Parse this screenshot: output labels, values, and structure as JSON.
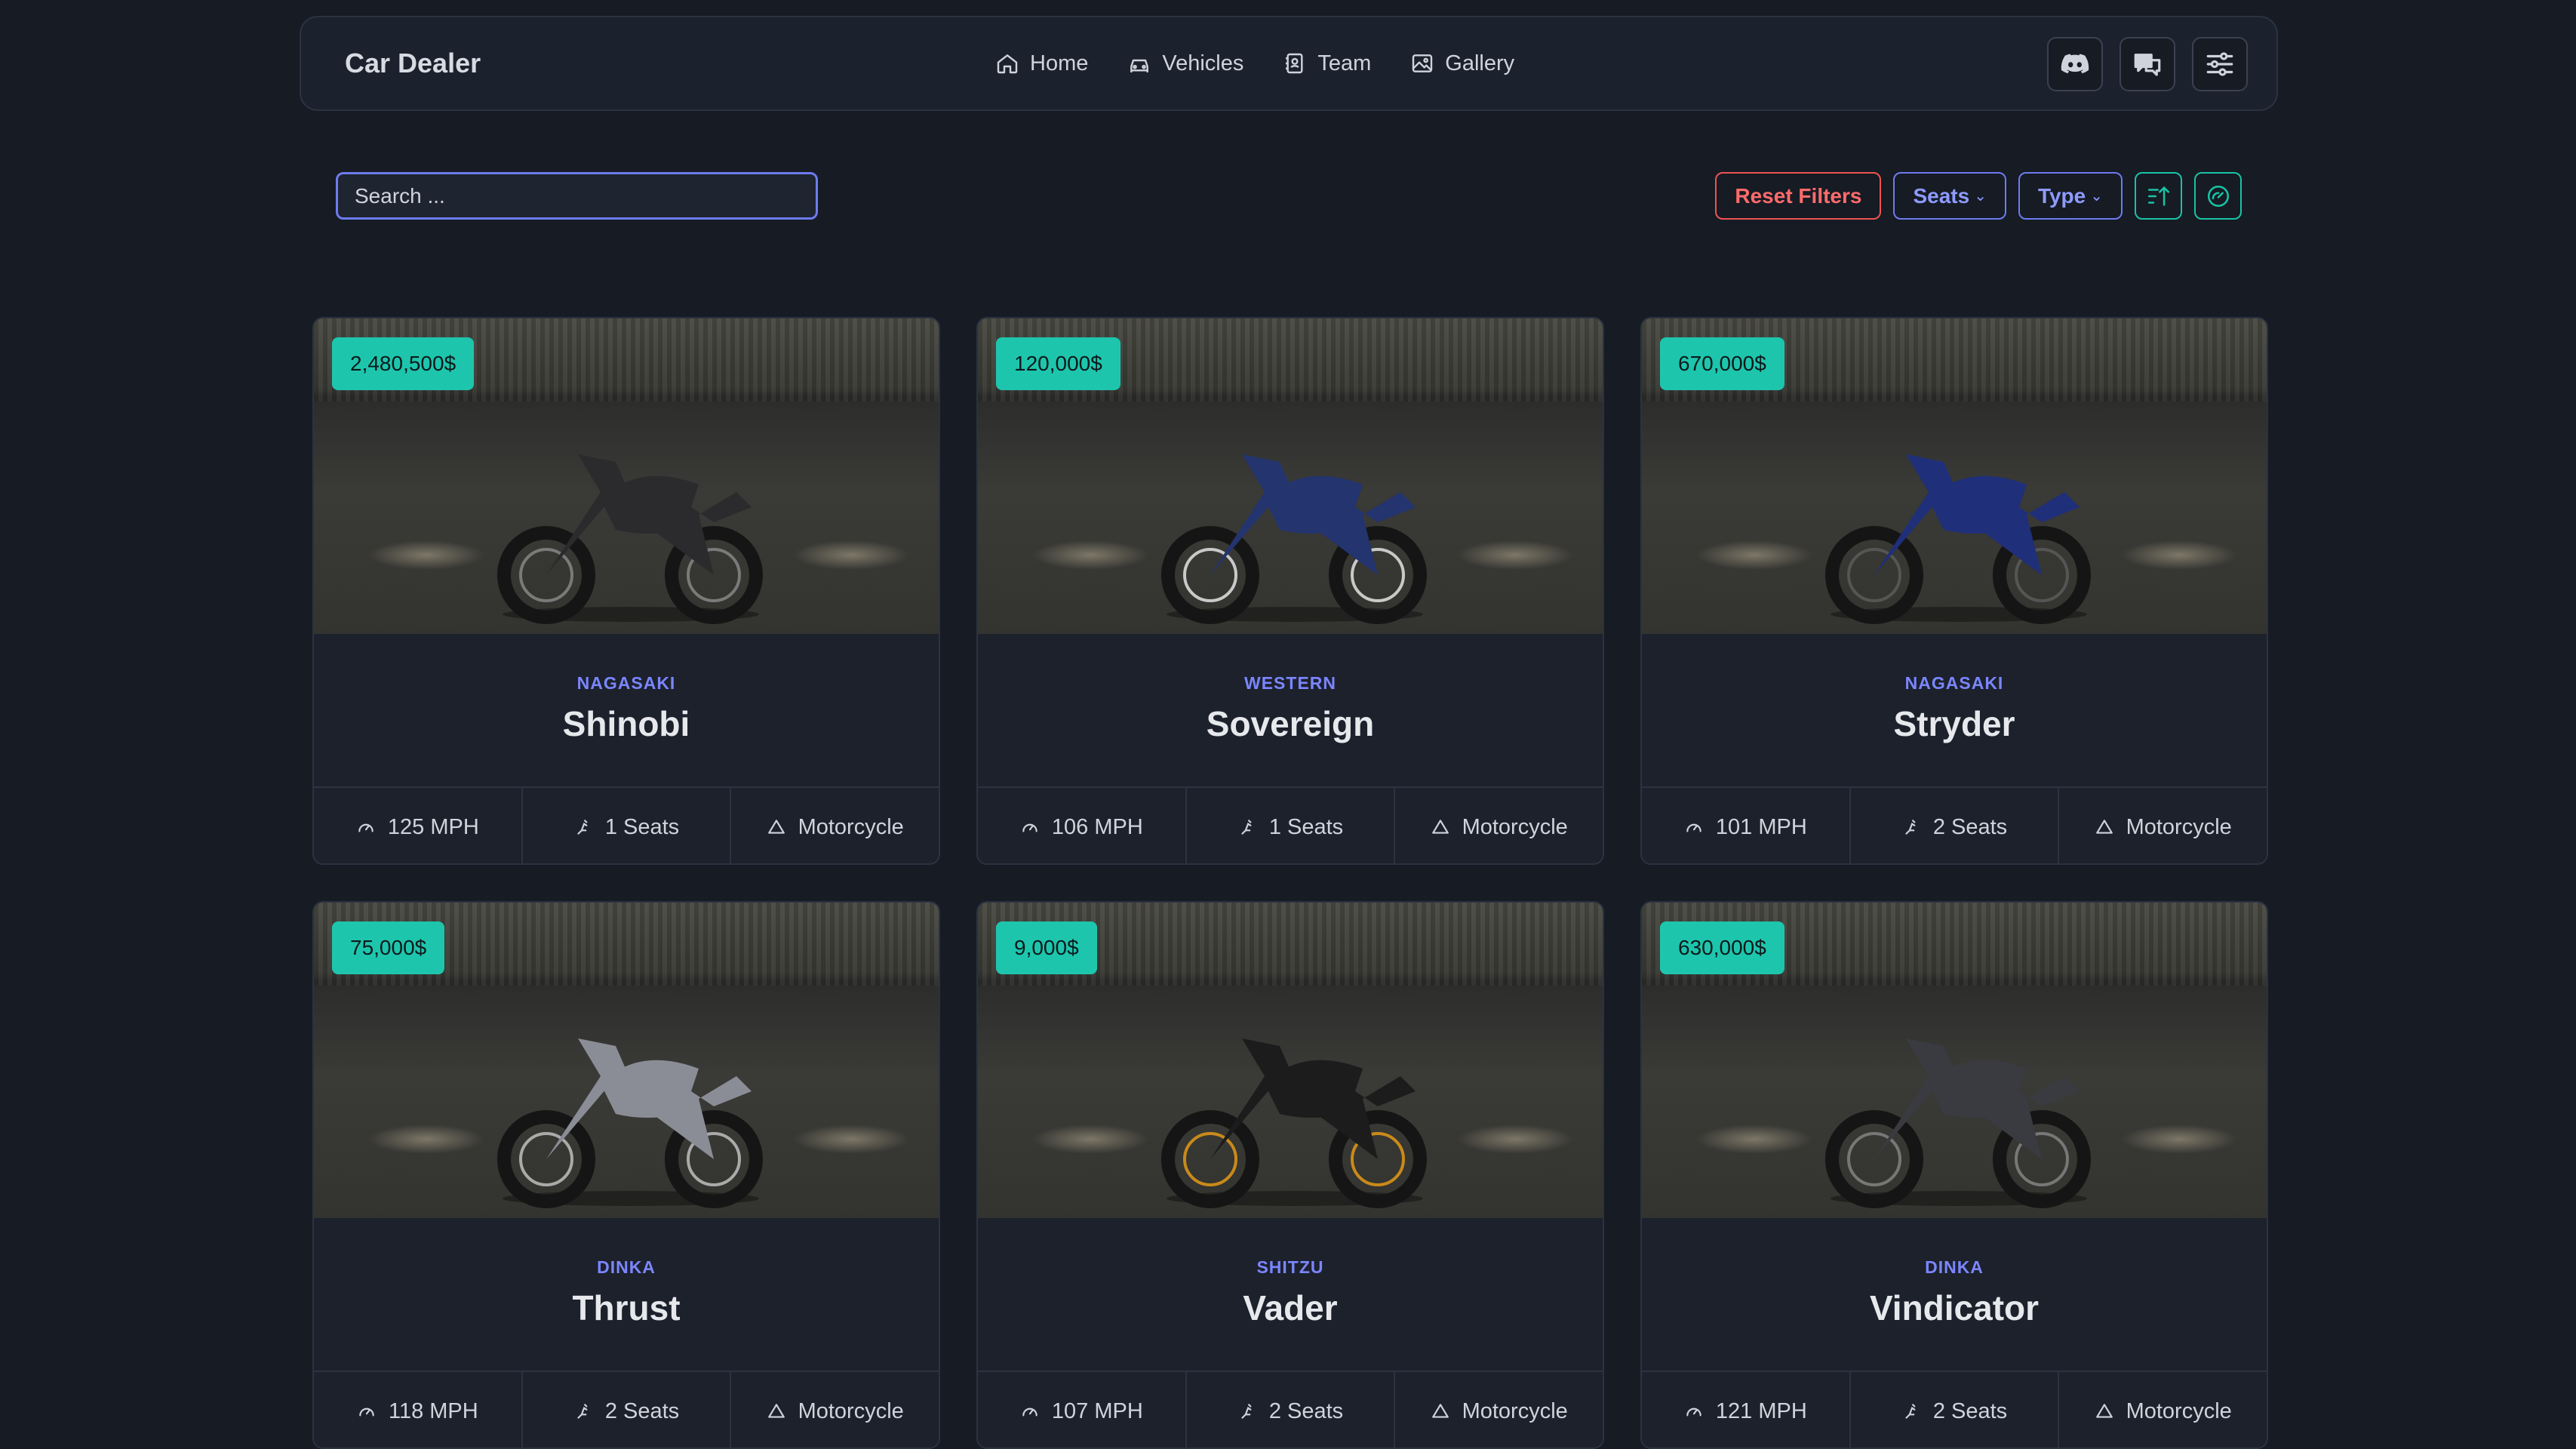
{
  "navbar": {
    "brand": "Car Dealer",
    "links": [
      {
        "label": "Home",
        "icon": "home-icon"
      },
      {
        "label": "Vehicles",
        "icon": "car-icon"
      },
      {
        "label": "Team",
        "icon": "contacts-icon"
      },
      {
        "label": "Gallery",
        "icon": "image-icon"
      }
    ],
    "icon_buttons": [
      "discord-icon",
      "messages-icon",
      "settings-sliders-icon"
    ]
  },
  "toolbar": {
    "search_placeholder": "Search ...",
    "reset_label": "Reset Filters",
    "seats_label": "Seats",
    "type_label": "Type",
    "sort_icon": "sort-ascending-icon",
    "speed_icon": "gauge-icon"
  },
  "colors": {
    "background": "#161b24",
    "accent_teal": "#1ec5ad",
    "accent_indigo": "#7b86ff",
    "danger": "#ef5350"
  },
  "vehicles": [
    {
      "price": "2,480,500$",
      "brand": "NAGASAKI",
      "name": "Shinobi",
      "speed": "125 MPH",
      "seats": "1 Seats",
      "type": "Motorcycle"
    },
    {
      "price": "120,000$",
      "brand": "WESTERN",
      "name": "Sovereign",
      "speed": "106 MPH",
      "seats": "1 Seats",
      "type": "Motorcycle"
    },
    {
      "price": "670,000$",
      "brand": "NAGASAKI",
      "name": "Stryder",
      "speed": "101 MPH",
      "seats": "2 Seats",
      "type": "Motorcycle"
    },
    {
      "price": "75,000$",
      "brand": "DINKA",
      "name": "Thrust",
      "speed": "118 MPH",
      "seats": "2 Seats",
      "type": "Motorcycle"
    },
    {
      "price": "9,000$",
      "brand": "SHITZU",
      "name": "Vader",
      "speed": "107 MPH",
      "seats": "2 Seats",
      "type": "Motorcycle"
    },
    {
      "price": "630,000$",
      "brand": "DINKA",
      "name": "Vindicator",
      "speed": "121 MPH",
      "seats": "2 Seats",
      "type": "Motorcycle"
    }
  ]
}
